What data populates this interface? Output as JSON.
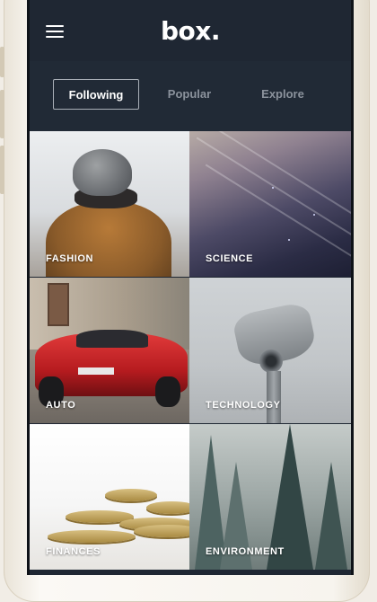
{
  "app": {
    "logo": "box."
  },
  "header": {
    "menu_icon": "menu-icon"
  },
  "tabs": [
    {
      "label": "Following",
      "active": true
    },
    {
      "label": "Popular",
      "active": false
    },
    {
      "label": "Explore",
      "active": false
    }
  ],
  "categories": [
    {
      "label": "FASHION"
    },
    {
      "label": "SCIENCE"
    },
    {
      "label": "AUTO"
    },
    {
      "label": "TECHNOLOGY"
    },
    {
      "label": "FINANCES"
    },
    {
      "label": "ENVIRONMENT"
    }
  ],
  "colors": {
    "header_bg": "#1f2733",
    "active_tab_border": "#aab0b8",
    "inactive_tab_text": "#8b929c"
  }
}
